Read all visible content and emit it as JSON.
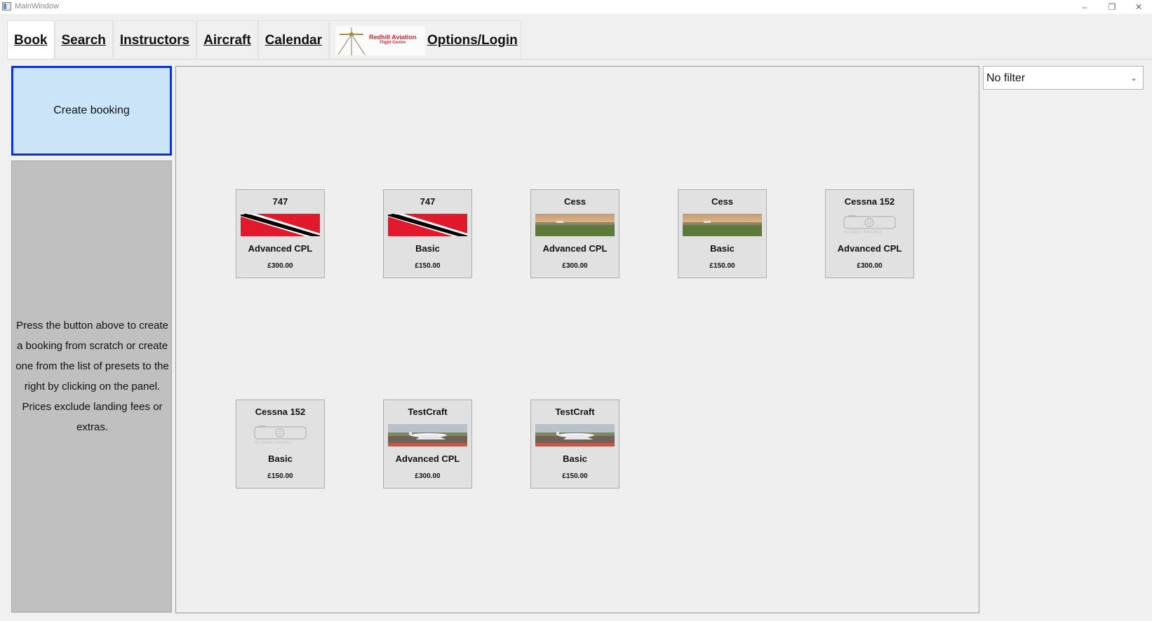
{
  "window": {
    "title": "MainWindow",
    "controls": {
      "minimize": "–",
      "restore": "❐",
      "close": "✕"
    }
  },
  "tabs": [
    {
      "label": "Book",
      "active": true
    },
    {
      "label": "Search"
    },
    {
      "label": "Instructors"
    },
    {
      "label": "Aircraft"
    },
    {
      "label": "Calendar"
    }
  ],
  "logo": {
    "line1": "Redhill Aviation",
    "line2": "Flight Centre"
  },
  "options_tab": {
    "label": "Options/Login"
  },
  "create_button": {
    "label": "Create booking"
  },
  "help": {
    "text": "Press the button above to create a booking from scratch or create one from the list of presets to the right by clicking on the panel. Prices exclude landing fees or extras."
  },
  "filter": {
    "value": "No filter"
  },
  "presets": [
    {
      "aircraft": "747",
      "course": "Advanced CPL",
      "price": "£300.00",
      "image": "flag"
    },
    {
      "aircraft": "747",
      "course": "Basic",
      "price": "£150.00",
      "image": "flag"
    },
    {
      "aircraft": "Cess",
      "course": "Advanced CPL",
      "price": "£300.00",
      "image": "field"
    },
    {
      "aircraft": "Cess",
      "course": "Basic",
      "price": "£150.00",
      "image": "field"
    },
    {
      "aircraft": "Cessna 152",
      "course": "Advanced CPL",
      "price": "£300.00",
      "image": "no-image"
    },
    {
      "aircraft": "Cessna 152",
      "course": "Basic",
      "price": "£150.00",
      "image": "no-image"
    },
    {
      "aircraft": "TestCraft",
      "course": "Advanced CPL",
      "price": "£300.00",
      "image": "jet"
    },
    {
      "aircraft": "TestCraft",
      "course": "Basic",
      "price": "£150.00",
      "image": "jet"
    }
  ]
}
